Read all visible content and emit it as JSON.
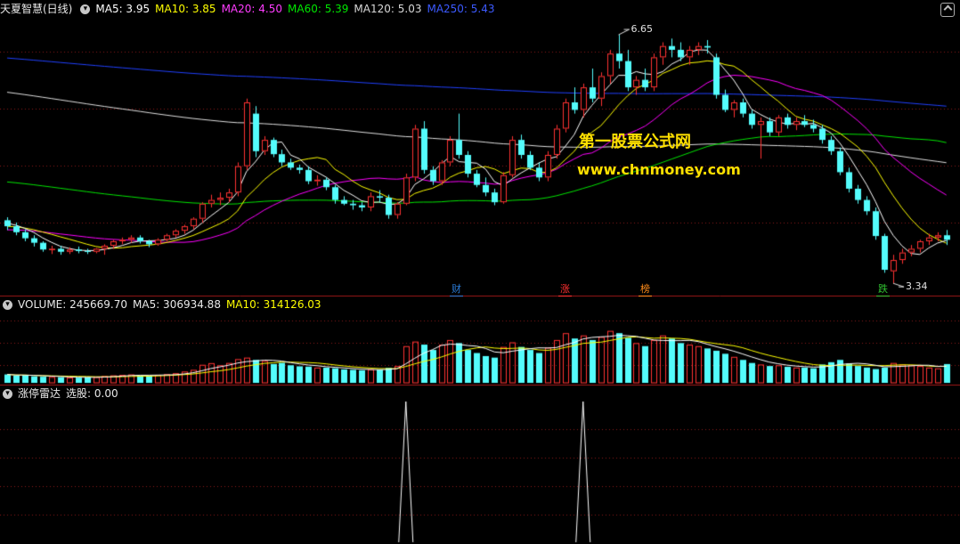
{
  "main_header": {
    "stock_name": "天夏智慧(日线)",
    "ma5": "MA5: 3.95",
    "ma10": "MA10: 3.85",
    "ma20": "MA20: 4.50",
    "ma60": "MA60: 5.39",
    "ma120": "MA120: 5.03",
    "ma250": "MA250: 5.43"
  },
  "volume_header": {
    "volume": "VOLUME: 245669.70",
    "ma5": "MA5: 306934.88",
    "ma10": "MA10: 314126.03"
  },
  "indicator_header": {
    "name": "涨停雷达",
    "value": "选股: 0.00"
  },
  "annotations": {
    "high_label": "6.65",
    "low_label": "3.34",
    "watermark_title": "第一股票公式网",
    "watermark_url": "www.chnmoney.com"
  },
  "event_tags": [
    {
      "text": "财",
      "color": "#2a7bd6"
    },
    {
      "text": "涨",
      "color": "#ff3030"
    },
    {
      "text": "榜",
      "color": "#ff8c1a"
    },
    {
      "text": "跌",
      "color": "#30c030"
    }
  ],
  "colors": {
    "up": "#ff3232",
    "down": "#54fcfc",
    "ma5": "#ffffff",
    "ma10": "#ffff00",
    "ma20": "#ff00ff",
    "ma60": "#00e600",
    "ma120": "#e0e0e0",
    "ma250": "#2040ff",
    "grid": "#8b1a1a"
  },
  "chart_data": {
    "type": "candlestick",
    "price_range": [
      3.2,
      6.9
    ],
    "candles": [
      [
        4.18,
        4.22,
        4.05,
        4.1
      ],
      [
        4.1,
        4.15,
        3.98,
        4.02
      ],
      [
        4.02,
        4.06,
        3.9,
        3.94
      ],
      [
        3.94,
        3.98,
        3.83,
        3.88
      ],
      [
        3.88,
        3.9,
        3.76,
        3.79
      ],
      [
        3.79,
        3.84,
        3.73,
        3.8
      ],
      [
        3.8,
        3.84,
        3.72,
        3.76
      ],
      [
        3.76,
        3.82,
        3.73,
        3.79
      ],
      [
        3.79,
        3.83,
        3.74,
        3.77
      ],
      [
        3.77,
        3.8,
        3.73,
        3.76
      ],
      [
        3.76,
        3.81,
        3.74,
        3.8
      ],
      [
        3.8,
        3.86,
        3.72,
        3.84
      ],
      [
        3.84,
        3.92,
        3.8,
        3.9
      ],
      [
        3.9,
        3.95,
        3.86,
        3.92
      ],
      [
        3.92,
        3.98,
        3.88,
        3.95
      ],
      [
        3.95,
        3.98,
        3.87,
        3.9
      ],
      [
        3.9,
        3.92,
        3.82,
        3.86
      ],
      [
        3.86,
        3.94,
        3.84,
        3.92
      ],
      [
        3.92,
        4.0,
        3.9,
        3.98
      ],
      [
        3.98,
        4.06,
        3.95,
        4.04
      ],
      [
        4.04,
        4.12,
        4.0,
        4.1
      ],
      [
        4.1,
        4.22,
        4.06,
        4.2
      ],
      [
        4.2,
        4.42,
        4.15,
        4.4
      ],
      [
        4.4,
        4.52,
        4.35,
        4.45
      ],
      [
        4.45,
        4.55,
        4.38,
        4.48
      ],
      [
        4.48,
        4.6,
        4.42,
        4.55
      ],
      [
        4.55,
        4.95,
        4.5,
        4.9
      ],
      [
        4.9,
        5.8,
        4.85,
        5.75
      ],
      [
        5.6,
        5.7,
        5.02,
        5.1
      ],
      [
        5.1,
        5.3,
        5.05,
        5.25
      ],
      [
        5.25,
        5.28,
        5.02,
        5.06
      ],
      [
        5.06,
        5.12,
        4.9,
        4.95
      ],
      [
        4.95,
        5.0,
        4.85,
        4.88
      ],
      [
        4.88,
        4.92,
        4.8,
        4.85
      ],
      [
        4.85,
        4.9,
        4.66,
        4.7
      ],
      [
        4.7,
        4.78,
        4.64,
        4.72
      ],
      [
        4.72,
        4.75,
        4.58,
        4.62
      ],
      [
        4.62,
        4.65,
        4.4,
        4.45
      ],
      [
        4.45,
        4.5,
        4.38,
        4.4
      ],
      [
        4.4,
        4.45,
        4.32,
        4.38
      ],
      [
        4.38,
        4.42,
        4.3,
        4.35
      ],
      [
        4.35,
        4.55,
        4.3,
        4.5
      ],
      [
        4.5,
        4.58,
        4.42,
        4.48
      ],
      [
        4.48,
        4.52,
        4.2,
        4.25
      ],
      [
        4.25,
        4.42,
        4.2,
        4.4
      ],
      [
        4.4,
        4.8,
        4.38,
        4.75
      ],
      [
        4.75,
        5.45,
        4.7,
        5.4
      ],
      [
        5.4,
        5.5,
        4.8,
        4.85
      ],
      [
        4.85,
        4.9,
        4.65,
        4.7
      ],
      [
        4.7,
        4.98,
        4.65,
        4.95
      ],
      [
        4.95,
        5.3,
        4.9,
        5.25
      ],
      [
        5.25,
        5.6,
        5.0,
        5.05
      ],
      [
        5.05,
        5.1,
        4.75,
        4.8
      ],
      [
        4.8,
        4.85,
        4.62,
        4.65
      ],
      [
        4.65,
        4.75,
        4.5,
        4.55
      ],
      [
        4.55,
        4.6,
        4.38,
        4.42
      ],
      [
        4.42,
        4.82,
        4.4,
        4.78
      ],
      [
        4.78,
        5.3,
        4.75,
        5.25
      ],
      [
        5.25,
        5.32,
        5.0,
        5.05
      ],
      [
        5.05,
        5.1,
        4.85,
        4.88
      ],
      [
        4.88,
        4.95,
        4.7,
        4.75
      ],
      [
        4.75,
        5.1,
        4.7,
        5.05
      ],
      [
        5.05,
        5.45,
        5.0,
        5.4
      ],
      [
        5.4,
        5.8,
        5.35,
        5.75
      ],
      [
        5.75,
        5.95,
        5.6,
        5.65
      ],
      [
        5.65,
        6.0,
        5.55,
        5.95
      ],
      [
        5.95,
        6.2,
        5.75,
        5.8
      ],
      [
        5.8,
        6.15,
        5.7,
        6.1
      ],
      [
        6.1,
        6.45,
        6.0,
        6.4
      ],
      [
        6.4,
        6.65,
        6.2,
        6.3
      ],
      [
        6.3,
        6.45,
        5.9,
        5.95
      ],
      [
        5.95,
        6.1,
        5.85,
        6.05
      ],
      [
        6.05,
        6.2,
        5.9,
        5.95
      ],
      [
        5.95,
        6.4,
        5.9,
        6.35
      ],
      [
        6.35,
        6.55,
        6.25,
        6.5
      ],
      [
        6.5,
        6.6,
        6.35,
        6.45
      ],
      [
        6.45,
        6.55,
        6.3,
        6.35
      ],
      [
        6.35,
        6.5,
        6.25,
        6.45
      ],
      [
        6.45,
        6.55,
        6.38,
        6.5
      ],
      [
        6.5,
        6.58,
        6.4,
        6.48
      ],
      [
        6.35,
        6.4,
        5.8,
        5.85
      ],
      [
        5.85,
        5.92,
        5.62,
        5.65
      ],
      [
        5.65,
        5.78,
        5.55,
        5.75
      ],
      [
        5.75,
        5.8,
        5.55,
        5.6
      ],
      [
        5.6,
        5.65,
        5.4,
        5.45
      ],
      [
        5.45,
        5.55,
        5.0,
        5.5
      ],
      [
        5.5,
        5.55,
        5.3,
        5.35
      ],
      [
        5.35,
        5.58,
        5.3,
        5.55
      ],
      [
        5.55,
        5.6,
        5.4,
        5.45
      ],
      [
        5.45,
        5.55,
        5.38,
        5.5
      ],
      [
        5.5,
        5.58,
        5.42,
        5.45
      ],
      [
        5.45,
        5.52,
        5.35,
        5.4
      ],
      [
        5.4,
        5.45,
        5.2,
        5.25
      ],
      [
        5.25,
        5.3,
        5.05,
        5.1
      ],
      [
        5.1,
        5.15,
        4.78,
        4.82
      ],
      [
        4.82,
        4.88,
        4.55,
        4.6
      ],
      [
        4.6,
        4.65,
        4.4,
        4.45
      ],
      [
        4.45,
        4.5,
        4.25,
        4.3
      ],
      [
        4.3,
        4.35,
        3.92,
        3.97
      ],
      [
        3.97,
        4.0,
        3.48,
        3.52
      ],
      [
        3.5,
        3.72,
        3.34,
        3.65
      ],
      [
        3.65,
        3.8,
        3.6,
        3.75
      ],
      [
        3.75,
        3.85,
        3.7,
        3.8
      ],
      [
        3.8,
        3.92,
        3.75,
        3.9
      ],
      [
        3.9,
        4.0,
        3.85,
        3.95
      ],
      [
        3.95,
        4.02,
        3.9,
        3.98
      ],
      [
        3.98,
        4.05,
        3.85,
        3.92
      ]
    ],
    "volume_range": [
      0,
      920000
    ],
    "volume": [
      110000,
      95000,
      100000,
      85000,
      80000,
      78000,
      74000,
      70000,
      68000,
      72000,
      76000,
      90000,
      98000,
      104000,
      110000,
      96000,
      92000,
      104000,
      114000,
      126000,
      148000,
      170000,
      236000,
      258000,
      230000,
      260000,
      310000,
      330000,
      300000,
      286000,
      246000,
      262000,
      230000,
      216000,
      212000,
      200000,
      198000,
      190000,
      176000,
      170000,
      164000,
      176000,
      172000,
      196000,
      220000,
      480000,
      540000,
      500000,
      430000,
      500000,
      560000,
      520000,
      430000,
      390000,
      350000,
      330000,
      470000,
      530000,
      470000,
      430000,
      390000,
      460000,
      560000,
      650000,
      580000,
      620000,
      560000,
      600000,
      680000,
      650000,
      590000,
      520000,
      480000,
      560000,
      620000,
      580000,
      520000,
      500000,
      480000,
      450000,
      420000,
      380000,
      340000,
      300000,
      260000,
      240000,
      220000,
      230000,
      210000,
      200000,
      200000,
      190000,
      240000,
      270000,
      300000,
      250000,
      220000,
      200000,
      180000,
      200000,
      260000,
      240000,
      230000,
      220000,
      200000,
      190000,
      245670
    ],
    "signal_spikes": [
      45,
      65
    ]
  }
}
